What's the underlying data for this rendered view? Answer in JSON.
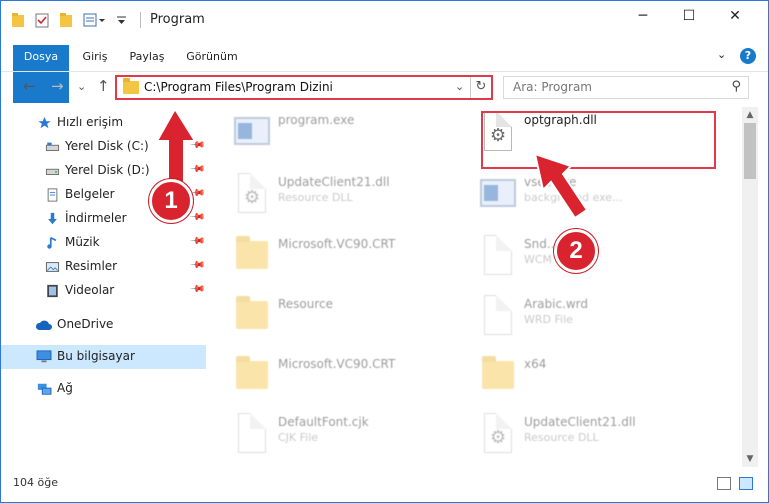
{
  "window": {
    "title": "Program",
    "controls": {
      "minimize": "─",
      "maximize": "☐",
      "close": "✕"
    }
  },
  "ribbon": {
    "tabs": [
      "Dosya",
      "Giriş",
      "Paylaş",
      "Görünüm"
    ],
    "collapse_glyph": "⌄",
    "help_glyph": "?"
  },
  "address_bar": {
    "back": "←",
    "forward": "→",
    "recent": "⌄",
    "up": "↑",
    "path": "C:\\Program Files\\Program Dizini",
    "dropdown": "⌄",
    "refresh": "↻"
  },
  "search": {
    "placeholder": "Ara: Program",
    "icon": "search-icon",
    "glyph": "⚲"
  },
  "nav": {
    "pin_glyph": "📌",
    "items": [
      {
        "label": "Hızlı erişim",
        "icon": "star-icon"
      },
      {
        "label": "Yerel Disk (C:)",
        "icon": "drive-icon",
        "pinned": true
      },
      {
        "label": "Yerel Disk (D:)",
        "icon": "drive-icon",
        "pinned": true
      },
      {
        "label": "Belgeler",
        "icon": "documents-icon",
        "pinned": true
      },
      {
        "label": "İndirmeler",
        "icon": "download-icon",
        "pinned": true
      },
      {
        "label": "Müzik",
        "icon": "music-icon",
        "pinned": true
      },
      {
        "label": "Resimler",
        "icon": "pictures-icon",
        "pinned": true
      },
      {
        "label": "Videolar",
        "icon": "video-icon",
        "pinned": true
      },
      {
        "label": "OneDrive",
        "icon": "cloud-icon"
      },
      {
        "label": "Bu bilgisayar",
        "icon": "computer-icon",
        "selected": true
      },
      {
        "label": "Ağ",
        "icon": "network-icon"
      }
    ]
  },
  "files": [
    {
      "name": "program.exe",
      "type": "",
      "icon": "exe-icon"
    },
    {
      "name": "optgraph.dll",
      "type": "",
      "icon": "dll-icon"
    },
    {
      "name": "UpdateClient21.dll",
      "type": "Resource DLL",
      "icon": "dll-icon"
    },
    {
      "name": "vsec.exe",
      "type": "background exe...",
      "icon": "exe-icon"
    },
    {
      "name": "Microsoft.VC90.CRT",
      "type": "",
      "icon": "folder-icon"
    },
    {
      "name": "Snd...wcm",
      "type": "WCM",
      "icon": "file-icon"
    },
    {
      "name": "Resource",
      "type": "",
      "icon": "folder-icon"
    },
    {
      "name": "Arabic.wrd",
      "type": "WRD File",
      "icon": "file-icon"
    },
    {
      "name": "Microsoft.VC90.CRT",
      "type": "",
      "icon": "folder-icon"
    },
    {
      "name": "x64",
      "type": "",
      "icon": "folder-icon"
    },
    {
      "name": "DefaultFont.cjk",
      "type": "CJK File",
      "icon": "file-icon"
    },
    {
      "name": "UpdateClient21.dll",
      "type": "Resource DLL",
      "icon": "dll-icon"
    }
  ],
  "annotations": {
    "step1": "1",
    "step2": "2",
    "color": "#d9242f"
  },
  "status": {
    "item_count": "104 öğe"
  },
  "colors": {
    "accent": "#1979ca",
    "highlight": "#e03a4a",
    "selected_nav": "#cce8ff"
  }
}
